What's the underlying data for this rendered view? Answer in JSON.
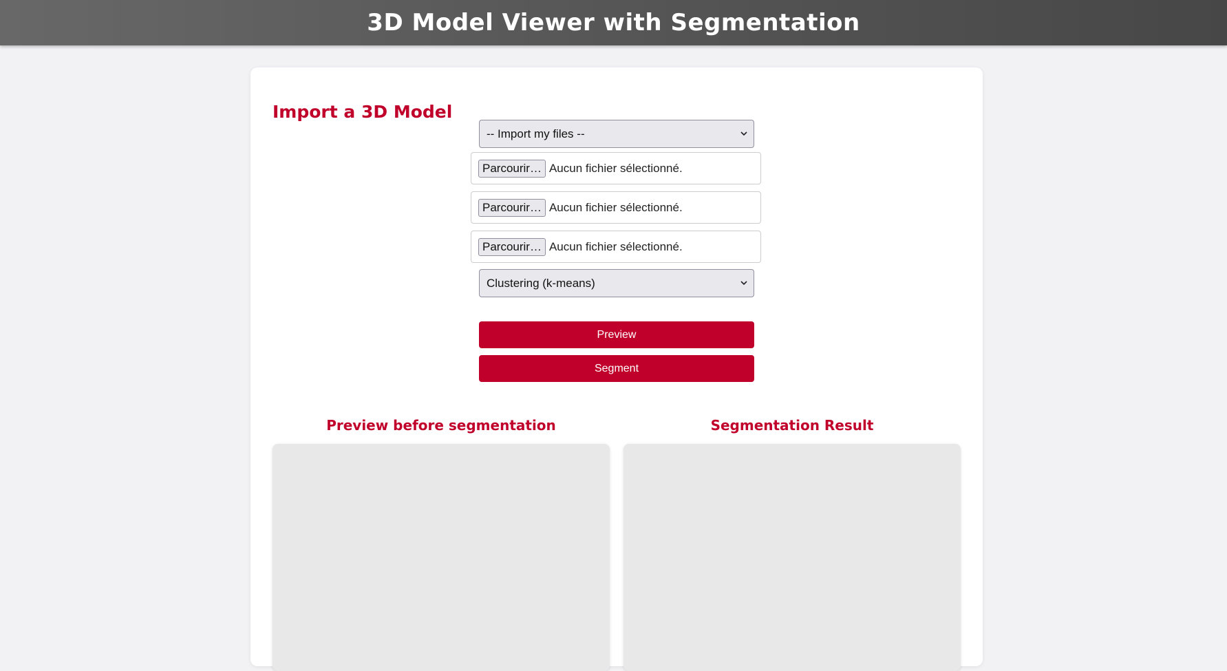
{
  "header": {
    "title": "3D Model Viewer with Segmentation"
  },
  "import_section": {
    "title": "Import a 3D Model",
    "source_select": {
      "value": "-- Import my files --"
    },
    "file_inputs": [
      {
        "button_label": "Parcourir…",
        "status": "Aucun fichier sélectionné."
      },
      {
        "button_label": "Parcourir…",
        "status": "Aucun fichier sélectionné."
      },
      {
        "button_label": "Parcourir…",
        "status": "Aucun fichier sélectionné."
      }
    ],
    "method_select": {
      "value": "Clustering (k-means)"
    },
    "preview_button": "Preview",
    "segment_button": "Segment"
  },
  "panels": {
    "preview_title": "Preview before segmentation",
    "result_title": "Segmentation Result"
  },
  "colors": {
    "accent": "#c0002a",
    "header_bg": "#5a5a5a",
    "page_bg": "#f2f2f5",
    "viewer_bg": "#e8e8e8"
  },
  "icons": {
    "select_chevron": "chevron-down-icon"
  }
}
